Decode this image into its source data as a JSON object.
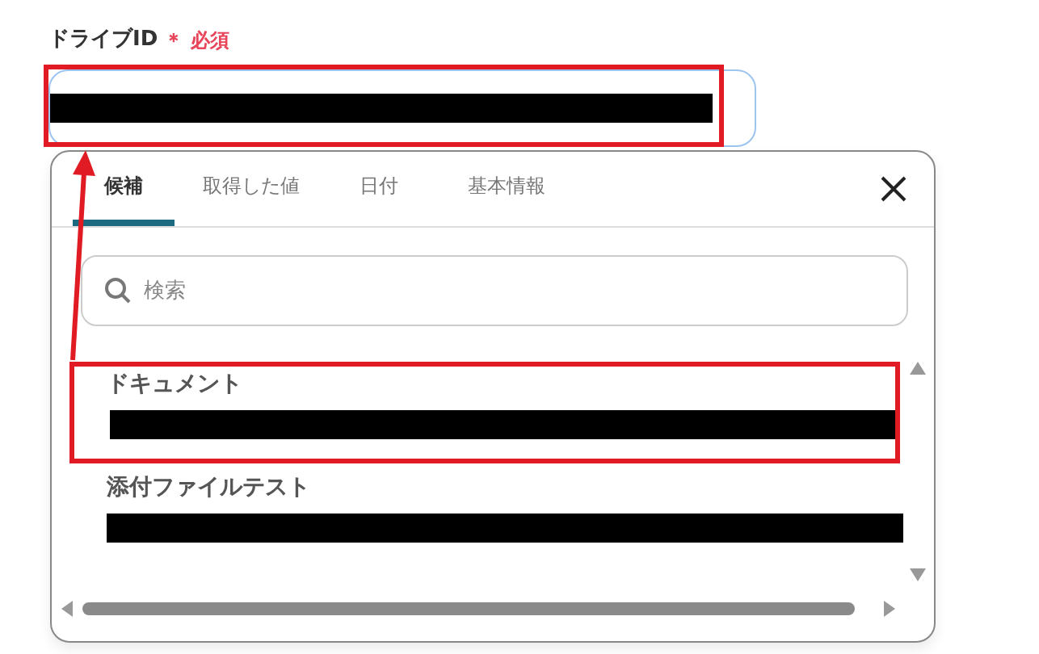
{
  "field": {
    "label": "ドライブID",
    "required_mark": "＊",
    "required_text": "必須",
    "value_redacted": true,
    "highlighted": true,
    "focused": true
  },
  "picker": {
    "tabs": [
      {
        "label": "候補",
        "selected": true
      },
      {
        "label": "取得した値",
        "selected": false
      },
      {
        "label": "日付",
        "selected": false
      },
      {
        "label": "基本情報",
        "selected": false
      }
    ],
    "search": {
      "placeholder": "検索"
    },
    "items": [
      {
        "title": "ドキュメント",
        "detail_redacted": true,
        "highlighted": true
      },
      {
        "title": "添付ファイルテスト",
        "detail_redacted": true,
        "highlighted": false
      }
    ]
  },
  "callout_arrow": true
}
